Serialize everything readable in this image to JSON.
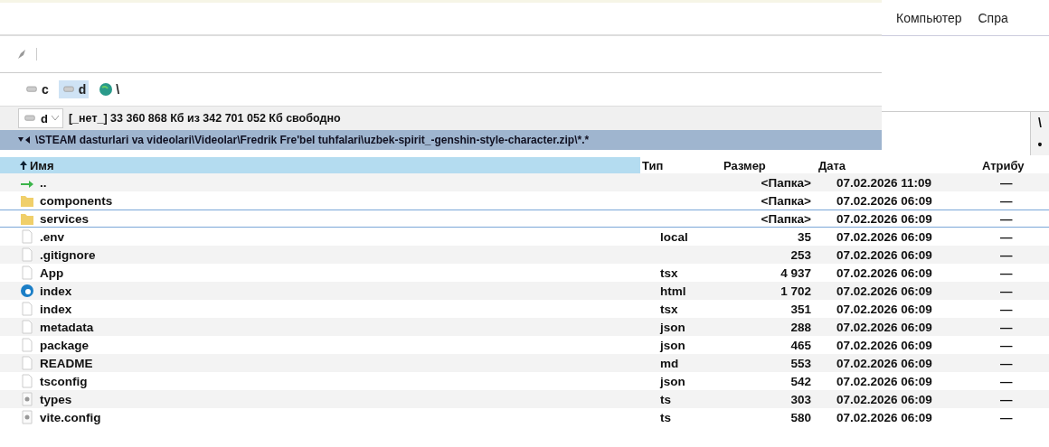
{
  "menu": [
    "Компьютер",
    "Спра"
  ],
  "drives": [
    {
      "letter": "c",
      "kind": "disk",
      "selected": false
    },
    {
      "letter": "d",
      "kind": "disk",
      "selected": true
    },
    {
      "letter": "\\",
      "kind": "network",
      "selected": false
    }
  ],
  "drive_combo": {
    "value": "d"
  },
  "drive_info": "[_нет_] 33 360 868 Кб из 342 701 052 Кб свободно",
  "path": "\\STEAM dasturlari va videolari\\Videolar\\Fredrik Fre'bel tuhfalari\\uzbek-spirit_-genshin-style-character.zip\\*.*",
  "right_panel": {
    "path_fragment": "\\",
    "marker": "•"
  },
  "columns": [
    "Имя",
    "Тип",
    "Размер",
    "Дата",
    "Атрибу"
  ],
  "rows": [
    {
      "kind": "up",
      "name": "..",
      "type": "",
      "size": "<Папка>",
      "date": "07.02.2026 11:09",
      "attr": "—",
      "selected": false
    },
    {
      "kind": "folder",
      "name": "components",
      "type": "",
      "size": "<Папка>",
      "date": "07.02.2026 06:09",
      "attr": "—",
      "selected": false
    },
    {
      "kind": "folder",
      "name": "services",
      "type": "",
      "size": "<Папка>",
      "date": "07.02.2026 06:09",
      "attr": "—",
      "selected": true
    },
    {
      "kind": "file",
      "name": ".env",
      "type": "local",
      "size": "35",
      "date": "07.02.2026 06:09",
      "attr": "—",
      "selected": false
    },
    {
      "kind": "file",
      "name": ".gitignore",
      "type": "",
      "size": "253",
      "date": "07.02.2026 06:09",
      "attr": "—",
      "selected": false
    },
    {
      "kind": "file",
      "name": "App",
      "type": "tsx",
      "size": "4 937",
      "date": "07.02.2026 06:09",
      "attr": "—",
      "selected": false
    },
    {
      "kind": "web",
      "name": "index",
      "type": "html",
      "size": "1 702",
      "date": "07.02.2026 06:09",
      "attr": "—",
      "selected": false
    },
    {
      "kind": "file",
      "name": "index",
      "type": "tsx",
      "size": "351",
      "date": "07.02.2026 06:09",
      "attr": "—",
      "selected": false
    },
    {
      "kind": "file",
      "name": "metadata",
      "type": "json",
      "size": "288",
      "date": "07.02.2026 06:09",
      "attr": "—",
      "selected": false
    },
    {
      "kind": "file",
      "name": "package",
      "type": "json",
      "size": "465",
      "date": "07.02.2026 06:09",
      "attr": "—",
      "selected": false
    },
    {
      "kind": "file",
      "name": "README",
      "type": "md",
      "size": "553",
      "date": "07.02.2026 06:09",
      "attr": "—",
      "selected": false
    },
    {
      "kind": "file",
      "name": "tsconfig",
      "type": "json",
      "size": "542",
      "date": "07.02.2026 06:09",
      "attr": "—",
      "selected": false
    },
    {
      "kind": "script",
      "name": "types",
      "type": "ts",
      "size": "303",
      "date": "07.02.2026 06:09",
      "attr": "—",
      "selected": false
    },
    {
      "kind": "script",
      "name": "vite.config",
      "type": "ts",
      "size": "580",
      "date": "07.02.2026 06:09",
      "attr": "—",
      "selected": false
    }
  ]
}
